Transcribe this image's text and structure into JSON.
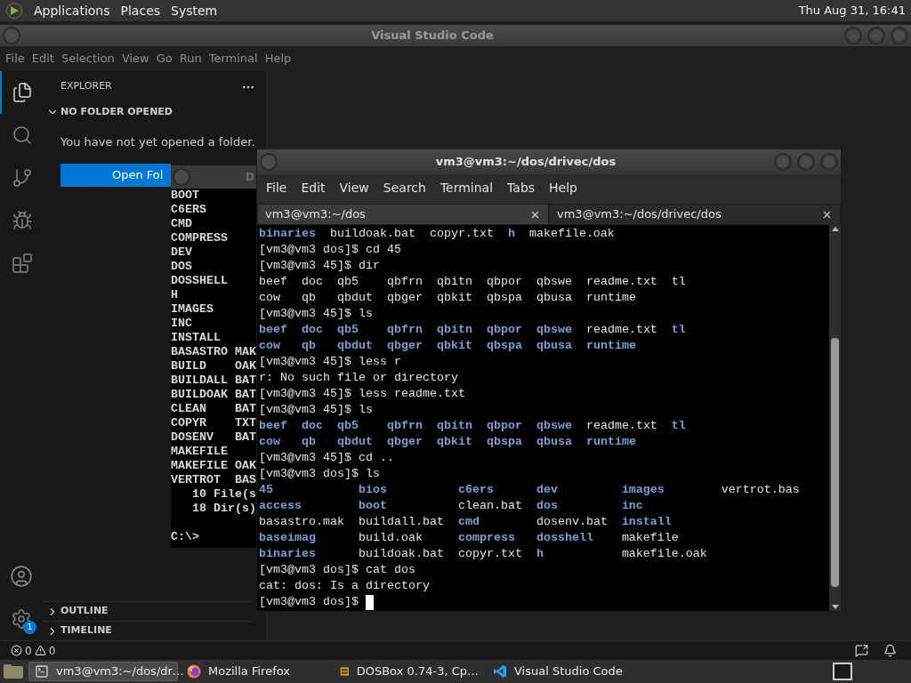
{
  "top_panel": {
    "menus": [
      "Applications",
      "Places",
      "System"
    ],
    "clock": "Thu Aug 31, 16:41"
  },
  "vscode": {
    "title": "Visual Studio Code",
    "menu": [
      "File",
      "Edit",
      "Selection",
      "View",
      "Go",
      "Run",
      "Terminal",
      "Help"
    ],
    "activity": [
      {
        "kind": "files",
        "selected": true
      },
      {
        "kind": "search",
        "selected": false
      },
      {
        "kind": "source-control",
        "selected": false
      },
      {
        "kind": "debug",
        "selected": false
      },
      {
        "kind": "extensions",
        "selected": false
      }
    ],
    "settings_badge": "1",
    "sidebar": {
      "title": "EXPLORER",
      "section": {
        "title": "NO FOLDER OPENED",
        "expanded": true
      },
      "message": "You have not yet opened a folder.",
      "button": "Open Fol",
      "panels": [
        {
          "title": "OUTLINE",
          "expanded": false
        },
        {
          "title": "TIMELINE",
          "expanded": false
        }
      ]
    },
    "status_bar": {
      "errors": "0",
      "warnings": "0"
    }
  },
  "dosbox": {
    "title": "D",
    "lines": [
      {
        "kind": "entry",
        "name": "BOOT"
      },
      {
        "kind": "entry",
        "name": "C6ERS"
      },
      {
        "kind": "entry",
        "name": "CMD"
      },
      {
        "kind": "entry",
        "name": "COMPRESS"
      },
      {
        "kind": "entry",
        "name": "DEV"
      },
      {
        "kind": "entry",
        "name": "DOS"
      },
      {
        "kind": "entry",
        "name": "DOSSHELL"
      },
      {
        "kind": "entry",
        "name": "H"
      },
      {
        "kind": "entry",
        "name": "IMAGES"
      },
      {
        "kind": "entry",
        "name": "INC"
      },
      {
        "kind": "entry",
        "name": "INSTALL"
      },
      {
        "kind": "entry",
        "name": "BASASTRO",
        "ext": "MAK"
      },
      {
        "kind": "entry",
        "name": "BUILD",
        "ext": "OAK"
      },
      {
        "kind": "entry",
        "name": "BUILDALL",
        "ext": "BAT"
      },
      {
        "kind": "entry",
        "name": "BUILDOAK",
        "ext": "BAT"
      },
      {
        "kind": "entry",
        "name": "CLEAN",
        "ext": "BAT"
      },
      {
        "kind": "entry",
        "name": "COPYR",
        "ext": "TXT"
      },
      {
        "kind": "entry",
        "name": "DOSENV",
        "ext": "BAT"
      },
      {
        "kind": "entry",
        "name": "MAKEFILE"
      },
      {
        "kind": "entry",
        "name": "MAKEFILE",
        "ext": "OAK"
      },
      {
        "kind": "entry",
        "name": "VERTROT",
        "ext": "BAS"
      },
      {
        "kind": "summary",
        "text": "10 File(s"
      },
      {
        "kind": "summary",
        "text": "18 Dir(s)"
      },
      {
        "kind": "blank"
      },
      {
        "kind": "prompt",
        "text": "C:\\>"
      }
    ]
  },
  "terminal": {
    "title": "vm3@vm3:~/dos/drivec/dos",
    "menu": [
      "File",
      "Edit",
      "View",
      "Search",
      "Terminal",
      "Tabs",
      "Help"
    ],
    "tabs": [
      {
        "label": "vm3@vm3:~/dos",
        "selected": false
      },
      {
        "label": "vm3@vm3:~/dos/drivec/dos",
        "selected": true
      }
    ],
    "blocks": [
      {
        "kind": "listing",
        "rows": [
          [
            {
              "text": "binaries",
              "dir": true
            },
            {
              "text": "buildoak.bat",
              "dir": false
            },
            {
              "text": "copyr.txt",
              "dir": false
            },
            {
              "text": "h",
              "dir": true
            },
            {
              "text": "makefile.oak",
              "dir": false
            }
          ]
        ]
      },
      {
        "kind": "text",
        "text": "[vm3@vm3 dos]$ cd 45"
      },
      {
        "kind": "text",
        "text": "[vm3@vm3 45]$ dir"
      },
      {
        "kind": "listing",
        "rows": [
          [
            {
              "text": "beef",
              "dir": false
            },
            {
              "text": "doc",
              "dir": false
            },
            {
              "text": "qb5",
              "dir": false
            },
            {
              "text": "qbfrn",
              "dir": false
            },
            {
              "text": "qbitn",
              "dir": false
            },
            {
              "text": "qbpor",
              "dir": false
            },
            {
              "text": "qbswe",
              "dir": false
            },
            {
              "text": "readme.txt",
              "dir": false
            },
            {
              "text": "tl",
              "dir": false
            }
          ],
          [
            {
              "text": "cow",
              "dir": false
            },
            {
              "text": "qb",
              "dir": false
            },
            {
              "text": "qbdut",
              "dir": false
            },
            {
              "text": "qbger",
              "dir": false
            },
            {
              "text": "qbkit",
              "dir": false
            },
            {
              "text": "qbspa",
              "dir": false
            },
            {
              "text": "qbusa",
              "dir": false
            },
            {
              "text": "runtime",
              "dir": false
            }
          ]
        ]
      },
      {
        "kind": "text",
        "text": "[vm3@vm3 45]$ ls"
      },
      {
        "kind": "listing",
        "rows": [
          [
            {
              "text": "beef",
              "dir": true
            },
            {
              "text": "doc",
              "dir": true
            },
            {
              "text": "qb5",
              "dir": true
            },
            {
              "text": "qbfrn",
              "dir": true
            },
            {
              "text": "qbitn",
              "dir": true
            },
            {
              "text": "qbpor",
              "dir": true
            },
            {
              "text": "qbswe",
              "dir": true
            },
            {
              "text": "readme.txt",
              "dir": false
            },
            {
              "text": "tl",
              "dir": true
            }
          ],
          [
            {
              "text": "cow",
              "dir": true
            },
            {
              "text": "qb",
              "dir": true
            },
            {
              "text": "qbdut",
              "dir": true
            },
            {
              "text": "qbger",
              "dir": true
            },
            {
              "text": "qbkit",
              "dir": true
            },
            {
              "text": "qbspa",
              "dir": true
            },
            {
              "text": "qbusa",
              "dir": true
            },
            {
              "text": "runtime",
              "dir": true
            }
          ]
        ]
      },
      {
        "kind": "text",
        "text": "[vm3@vm3 45]$ less r"
      },
      {
        "kind": "text",
        "text": "r: No such file or directory"
      },
      {
        "kind": "text",
        "text": "[vm3@vm3 45]$ less readme.txt"
      },
      {
        "kind": "text",
        "text": "[vm3@vm3 45]$ ls"
      },
      {
        "kind": "listing",
        "rows": [
          [
            {
              "text": "beef",
              "dir": true
            },
            {
              "text": "doc",
              "dir": true
            },
            {
              "text": "qb5",
              "dir": true
            },
            {
              "text": "qbfrn",
              "dir": true
            },
            {
              "text": "qbitn",
              "dir": true
            },
            {
              "text": "qbpor",
              "dir": true
            },
            {
              "text": "qbswe",
              "dir": true
            },
            {
              "text": "readme.txt",
              "dir": false
            },
            {
              "text": "tl",
              "dir": true
            }
          ],
          [
            {
              "text": "cow",
              "dir": true
            },
            {
              "text": "qb",
              "dir": true
            },
            {
              "text": "qbdut",
              "dir": true
            },
            {
              "text": "qbger",
              "dir": true
            },
            {
              "text": "qbkit",
              "dir": true
            },
            {
              "text": "qbspa",
              "dir": true
            },
            {
              "text": "qbusa",
              "dir": true
            },
            {
              "text": "runtime",
              "dir": true
            }
          ]
        ]
      },
      {
        "kind": "text",
        "text": "[vm3@vm3 45]$ cd .."
      },
      {
        "kind": "text",
        "text": "[vm3@vm3 dos]$ ls"
      },
      {
        "kind": "listing",
        "rows": [
          [
            {
              "text": "45",
              "dir": true
            },
            {
              "text": "bios",
              "dir": true
            },
            {
              "text": "c6ers",
              "dir": true
            },
            {
              "text": "dev",
              "dir": true
            },
            {
              "text": "images",
              "dir": true
            },
            {
              "text": "vertrot.bas",
              "dir": false
            }
          ],
          [
            {
              "text": "access",
              "dir": true
            },
            {
              "text": "boot",
              "dir": true
            },
            {
              "text": "clean.bat",
              "dir": false
            },
            {
              "text": "dos",
              "dir": true
            },
            {
              "text": "inc",
              "dir": true
            }
          ],
          [
            {
              "text": "basastro.mak",
              "dir": false
            },
            {
              "text": "buildall.bat",
              "dir": false
            },
            {
              "text": "cmd",
              "dir": true
            },
            {
              "text": "dosenv.bat",
              "dir": false
            },
            {
              "text": "install",
              "dir": true
            }
          ],
          [
            {
              "text": "baseimag",
              "dir": true
            },
            {
              "text": "build.oak",
              "dir": false
            },
            {
              "text": "compress",
              "dir": true
            },
            {
              "text": "dosshell",
              "dir": true
            },
            {
              "text": "makefile",
              "dir": false
            }
          ],
          [
            {
              "text": "binaries",
              "dir": true
            },
            {
              "text": "buildoak.bat",
              "dir": false
            },
            {
              "text": "copyr.txt",
              "dir": false
            },
            {
              "text": "h",
              "dir": true
            },
            {
              "text": "makefile.oak",
              "dir": false
            }
          ]
        ]
      },
      {
        "kind": "text",
        "text": "[vm3@vm3 dos]$ cat dos"
      },
      {
        "kind": "text",
        "text": "cat: dos: Is a directory"
      },
      {
        "kind": "prompt",
        "text": "[vm3@vm3 dos]$"
      }
    ]
  },
  "taskbar": {
    "items": [
      {
        "kind": "terminal",
        "label": "vm3@vm3:~/dos/dr…",
        "selected": true
      },
      {
        "kind": "firefox",
        "label": "Mozilla Firefox",
        "selected": false
      },
      {
        "kind": "dosbox",
        "label": "DOSBox 0.74-3, Cp…",
        "selected": false
      },
      {
        "kind": "vscode",
        "label": "Visual Studio Code",
        "selected": false
      }
    ]
  }
}
